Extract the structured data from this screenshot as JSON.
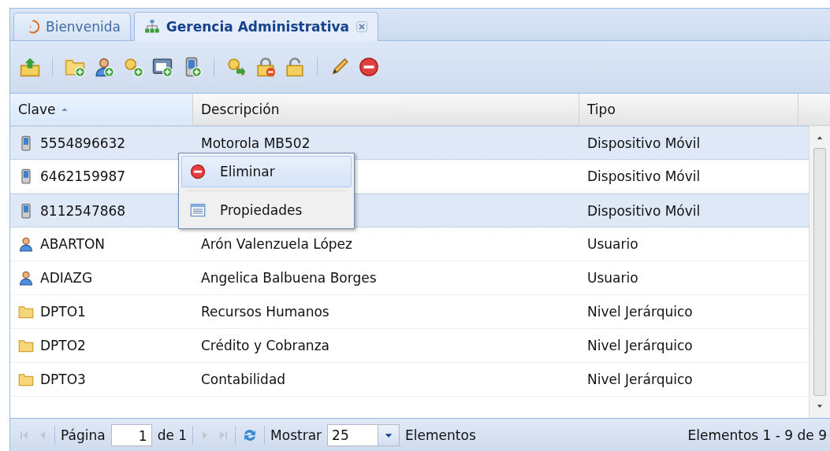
{
  "tabs": [
    {
      "label": "Bienvenida",
      "selected": false,
      "closable": false
    },
    {
      "label": "Gerencia Administrativa",
      "selected": true,
      "closable": true
    }
  ],
  "grid": {
    "columns": [
      {
        "label": "Clave",
        "sorted": true
      },
      {
        "label": "Descripción",
        "sorted": false
      },
      {
        "label": "Tipo",
        "sorted": false
      }
    ],
    "rows": [
      {
        "kind": "device",
        "key": "5554896632",
        "description": "Motorola MB502",
        "type": "Dispositivo Móvil",
        "selected": true
      },
      {
        "kind": "device",
        "key": "6462159987",
        "type": "Dispositivo Móvil",
        "selected": false
      },
      {
        "kind": "device",
        "key": "8112547868",
        "type": "Dispositivo Móvil",
        "selected": true
      },
      {
        "kind": "user",
        "key": "ABARTON",
        "description": "Arón Valenzuela López",
        "type": "Usuario",
        "selected": false
      },
      {
        "kind": "user",
        "key": "ADIAZG",
        "description": "Angelica Balbuena Borges",
        "type": "Usuario",
        "selected": false
      },
      {
        "kind": "folder",
        "key": "DPTO1",
        "description": "Recursos Humanos",
        "type": "Nivel Jerárquico",
        "selected": false
      },
      {
        "kind": "folder",
        "key": "DPTO2",
        "description": "Crédito y Cobranza",
        "type": "Nivel Jerárquico",
        "selected": false
      },
      {
        "kind": "folder",
        "key": "DPTO3",
        "description": "Contabilidad",
        "type": "Nivel Jerárquico",
        "selected": false
      }
    ]
  },
  "context_menu": {
    "items": [
      {
        "kind": "delete",
        "label": "Eliminar",
        "selected": true
      },
      {
        "kind": "properties",
        "label": "Propiedades",
        "selected": false
      }
    ]
  },
  "pager": {
    "page_label": "Página",
    "page": "1",
    "of_label": "de 1",
    "show_label": "Mostrar",
    "page_size": "25",
    "items_label": "Elementos",
    "summary": "Elementos 1 - 9 de 9"
  }
}
